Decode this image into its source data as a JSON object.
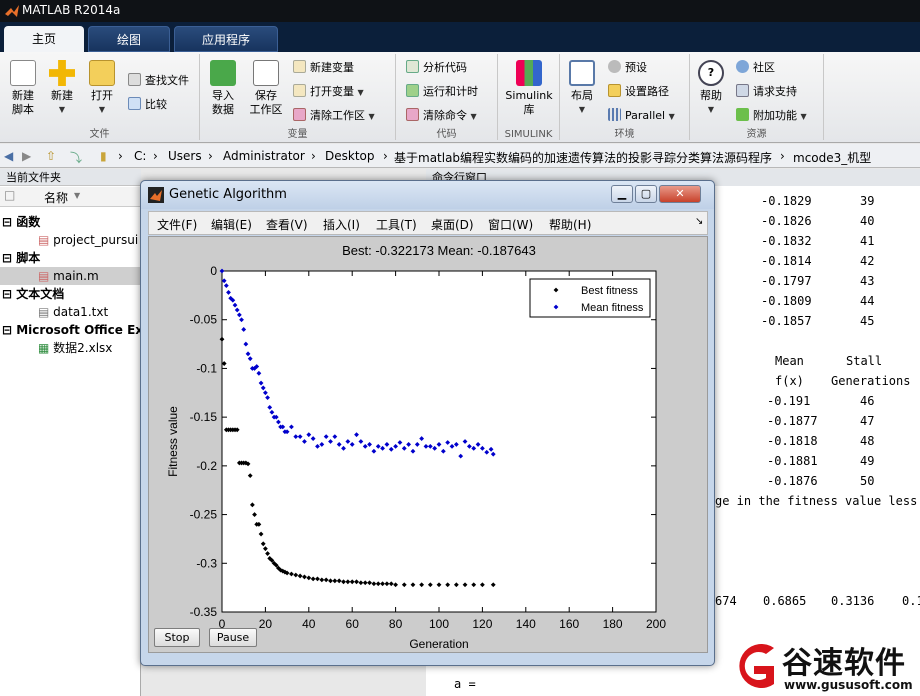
{
  "window": {
    "title": "MATLAB R2014a"
  },
  "tabs": [
    {
      "label": "主页"
    },
    {
      "label": "绘图"
    },
    {
      "label": "应用程序"
    }
  ],
  "ribbon": {
    "file": {
      "section": "文件",
      "new_script": "新建\n脚本",
      "new": "新建",
      "open": "打开",
      "find_files": "查找文件",
      "compare": "比较"
    },
    "variable": {
      "section": "变量",
      "import": "导入\n数据",
      "save_ws": "保存\n工作区",
      "new_var": "新建变量",
      "open_var": "打开变量",
      "clear_ws": "清除工作区"
    },
    "code": {
      "section": "代码",
      "analyze": "分析代码",
      "run_time": "运行和计时",
      "clear_cmd": "清除命令"
    },
    "simulink": {
      "section": "SIMULINK",
      "lib": "Simulink\n库"
    },
    "env": {
      "section": "环境",
      "layout": "布局",
      "prefs": "预设",
      "set_path": "设置路径",
      "parallel": "Parallel"
    },
    "res": {
      "section": "资源",
      "help": "帮助",
      "community": "社区",
      "support": "请求支持",
      "addons": "附加功能"
    }
  },
  "address": {
    "parts": [
      "C:",
      "Users",
      "Administrator",
      "Desktop",
      "基于matlab编程实数编码的加速遗传算法的投影寻踪分类算法源码程序",
      "mcode3_机型"
    ]
  },
  "current_folder": {
    "title": "当前文件夹",
    "col_name": "名称",
    "groups": [
      {
        "label": "函数",
        "items": [
          "project_pursui"
        ]
      },
      {
        "label": "脚本",
        "items": [
          "main.m"
        ]
      },
      {
        "label": "文本文档",
        "items": [
          "data1.txt"
        ]
      },
      {
        "label": "Microsoft Office Exc",
        "items": [
          "数据2.xlsx"
        ]
      }
    ]
  },
  "command_window": {
    "title": "命令行窗口",
    "rows1": [
      {
        "val": "-0.1829",
        "gen": "39"
      },
      {
        "val": "-0.1826",
        "gen": "40"
      },
      {
        "val": "-0.1832",
        "gen": "41"
      },
      {
        "val": "-0.1814",
        "gen": "42"
      },
      {
        "val": "-0.1797",
        "gen": "43"
      },
      {
        "val": "-0.1809",
        "gen": "44"
      },
      {
        "val": "-0.1857",
        "gen": "45"
      }
    ],
    "hdr1": {
      "mean": "Mean",
      "stall": "Stall"
    },
    "hdr2": {
      "mean": "f(x)",
      "stall": "Generations"
    },
    "rows2": [
      {
        "val": "-0.191",
        "gen": "46"
      },
      {
        "val": "-0.1877",
        "gen": "47"
      },
      {
        "val": "-0.1818",
        "gen": "48"
      },
      {
        "val": "-0.1881",
        "gen": "49"
      },
      {
        "val": "-0.1876",
        "gen": "50"
      }
    ],
    "msg": "ge in the fitness value less t",
    "nums": [
      "674",
      "0.6865",
      "0.3136",
      "0.1"
    ],
    "a_line": "a ="
  },
  "figure": {
    "title": "Genetic Algorithm",
    "menus": [
      "文件(F)",
      "编辑(E)",
      "查看(V)",
      "插入(I)",
      "工具(T)",
      "桌面(D)",
      "窗口(W)",
      "帮助(H)"
    ],
    "stop": "Stop",
    "pause": "Pause"
  },
  "chart_data": {
    "type": "scatter",
    "title": "Best: -0.322173 Mean: -0.187643",
    "xlabel": "Generation",
    "ylabel": "Fitness value",
    "xlim": [
      0,
      200
    ],
    "ylim": [
      -0.35,
      0
    ],
    "xticks": [
      "0",
      "20",
      "40",
      "60",
      "80",
      "100",
      "120",
      "140",
      "160",
      "180",
      "200"
    ],
    "yticks": [
      "0",
      "-0.05",
      "-0.1",
      "-0.15",
      "-0.2",
      "-0.25",
      "-0.3",
      "-0.35"
    ],
    "legend_position": "top-right",
    "series": [
      {
        "name": "Best fitness",
        "color": "#000000",
        "x": [
          0,
          1,
          2,
          3,
          4,
          5,
          6,
          7,
          8,
          9,
          10,
          11,
          12,
          13,
          14,
          15,
          16,
          17,
          18,
          19,
          20,
          21,
          22,
          23,
          24,
          25,
          26,
          27,
          28,
          29,
          30,
          32,
          34,
          36,
          38,
          40,
          42,
          44,
          46,
          48,
          50,
          52,
          54,
          56,
          58,
          60,
          62,
          64,
          66,
          68,
          70,
          72,
          74,
          76,
          78,
          80,
          84,
          88,
          92,
          96,
          100,
          104,
          108,
          112,
          116,
          120,
          125
        ],
        "y": [
          -0.07,
          -0.095,
          -0.163,
          -0.163,
          -0.163,
          -0.163,
          -0.163,
          -0.163,
          -0.197,
          -0.197,
          -0.197,
          -0.197,
          -0.198,
          -0.21,
          -0.24,
          -0.25,
          -0.26,
          -0.26,
          -0.27,
          -0.28,
          -0.285,
          -0.29,
          -0.295,
          -0.297,
          -0.3,
          -0.302,
          -0.305,
          -0.307,
          -0.308,
          -0.309,
          -0.31,
          -0.311,
          -0.312,
          -0.313,
          -0.314,
          -0.315,
          -0.316,
          -0.316,
          -0.317,
          -0.317,
          -0.318,
          -0.318,
          -0.318,
          -0.319,
          -0.319,
          -0.319,
          -0.319,
          -0.32,
          -0.32,
          -0.32,
          -0.321,
          -0.321,
          -0.321,
          -0.321,
          -0.321,
          -0.322,
          -0.322,
          -0.322,
          -0.322,
          -0.322,
          -0.322,
          -0.322,
          -0.322,
          -0.322,
          -0.322,
          -0.322,
          -0.322
        ]
      },
      {
        "name": "Mean fitness",
        "color": "#0000cc",
        "x": [
          0,
          1,
          2,
          3,
          4,
          5,
          6,
          7,
          8,
          9,
          10,
          11,
          12,
          13,
          14,
          15,
          16,
          17,
          18,
          19,
          20,
          21,
          22,
          23,
          24,
          25,
          26,
          27,
          28,
          29,
          30,
          32,
          34,
          36,
          38,
          40,
          42,
          44,
          46,
          48,
          50,
          52,
          54,
          56,
          58,
          60,
          62,
          64,
          66,
          68,
          70,
          72,
          74,
          76,
          78,
          80,
          82,
          84,
          86,
          88,
          90,
          92,
          94,
          96,
          98,
          100,
          102,
          104,
          106,
          108,
          110,
          112,
          114,
          116,
          118,
          120,
          122,
          124,
          125
        ],
        "y": [
          0,
          -0.01,
          -0.015,
          -0.022,
          -0.028,
          -0.03,
          -0.035,
          -0.04,
          -0.045,
          -0.05,
          -0.06,
          -0.075,
          -0.085,
          -0.09,
          -0.1,
          -0.1,
          -0.098,
          -0.105,
          -0.115,
          -0.12,
          -0.125,
          -0.13,
          -0.14,
          -0.145,
          -0.15,
          -0.15,
          -0.155,
          -0.16,
          -0.16,
          -0.165,
          -0.165,
          -0.16,
          -0.17,
          -0.17,
          -0.175,
          -0.168,
          -0.172,
          -0.18,
          -0.178,
          -0.17,
          -0.175,
          -0.17,
          -0.178,
          -0.182,
          -0.175,
          -0.178,
          -0.168,
          -0.175,
          -0.18,
          -0.178,
          -0.185,
          -0.18,
          -0.182,
          -0.178,
          -0.183,
          -0.18,
          -0.176,
          -0.182,
          -0.178,
          -0.185,
          -0.178,
          -0.172,
          -0.18,
          -0.18,
          -0.182,
          -0.178,
          -0.185,
          -0.176,
          -0.18,
          -0.178,
          -0.19,
          -0.175,
          -0.18,
          -0.182,
          -0.178,
          -0.182,
          -0.186,
          -0.183,
          -0.188
        ]
      }
    ]
  },
  "watermark": {
    "brand": "谷速软件",
    "url": "www.gususoft.com"
  }
}
